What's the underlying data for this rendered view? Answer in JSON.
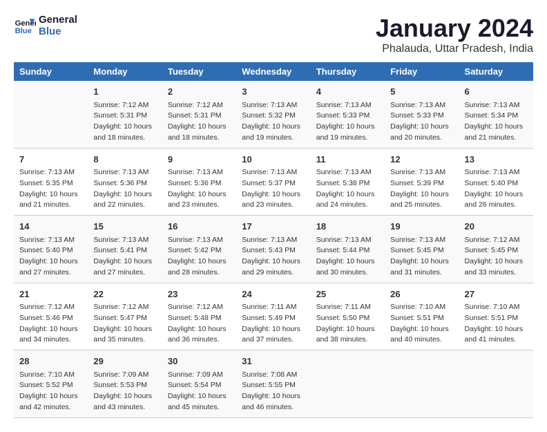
{
  "logo": {
    "line1": "General",
    "line2": "Blue"
  },
  "title": "January 2024",
  "subtitle": "Phalauda, Uttar Pradesh, India",
  "days_of_week": [
    "Sunday",
    "Monday",
    "Tuesday",
    "Wednesday",
    "Thursday",
    "Friday",
    "Saturday"
  ],
  "weeks": [
    [
      {
        "day": "",
        "info": ""
      },
      {
        "day": "1",
        "info": "Sunrise: 7:12 AM\nSunset: 5:31 PM\nDaylight: 10 hours\nand 18 minutes."
      },
      {
        "day": "2",
        "info": "Sunrise: 7:12 AM\nSunset: 5:31 PM\nDaylight: 10 hours\nand 18 minutes."
      },
      {
        "day": "3",
        "info": "Sunrise: 7:13 AM\nSunset: 5:32 PM\nDaylight: 10 hours\nand 19 minutes."
      },
      {
        "day": "4",
        "info": "Sunrise: 7:13 AM\nSunset: 5:33 PM\nDaylight: 10 hours\nand 19 minutes."
      },
      {
        "day": "5",
        "info": "Sunrise: 7:13 AM\nSunset: 5:33 PM\nDaylight: 10 hours\nand 20 minutes."
      },
      {
        "day": "6",
        "info": "Sunrise: 7:13 AM\nSunset: 5:34 PM\nDaylight: 10 hours\nand 21 minutes."
      }
    ],
    [
      {
        "day": "7",
        "info": "Sunrise: 7:13 AM\nSunset: 5:35 PM\nDaylight: 10 hours\nand 21 minutes."
      },
      {
        "day": "8",
        "info": "Sunrise: 7:13 AM\nSunset: 5:36 PM\nDaylight: 10 hours\nand 22 minutes."
      },
      {
        "day": "9",
        "info": "Sunrise: 7:13 AM\nSunset: 5:36 PM\nDaylight: 10 hours\nand 23 minutes."
      },
      {
        "day": "10",
        "info": "Sunrise: 7:13 AM\nSunset: 5:37 PM\nDaylight: 10 hours\nand 23 minutes."
      },
      {
        "day": "11",
        "info": "Sunrise: 7:13 AM\nSunset: 5:38 PM\nDaylight: 10 hours\nand 24 minutes."
      },
      {
        "day": "12",
        "info": "Sunrise: 7:13 AM\nSunset: 5:39 PM\nDaylight: 10 hours\nand 25 minutes."
      },
      {
        "day": "13",
        "info": "Sunrise: 7:13 AM\nSunset: 5:40 PM\nDaylight: 10 hours\nand 26 minutes."
      }
    ],
    [
      {
        "day": "14",
        "info": "Sunrise: 7:13 AM\nSunset: 5:40 PM\nDaylight: 10 hours\nand 27 minutes."
      },
      {
        "day": "15",
        "info": "Sunrise: 7:13 AM\nSunset: 5:41 PM\nDaylight: 10 hours\nand 27 minutes."
      },
      {
        "day": "16",
        "info": "Sunrise: 7:13 AM\nSunset: 5:42 PM\nDaylight: 10 hours\nand 28 minutes."
      },
      {
        "day": "17",
        "info": "Sunrise: 7:13 AM\nSunset: 5:43 PM\nDaylight: 10 hours\nand 29 minutes."
      },
      {
        "day": "18",
        "info": "Sunrise: 7:13 AM\nSunset: 5:44 PM\nDaylight: 10 hours\nand 30 minutes."
      },
      {
        "day": "19",
        "info": "Sunrise: 7:13 AM\nSunset: 5:45 PM\nDaylight: 10 hours\nand 31 minutes."
      },
      {
        "day": "20",
        "info": "Sunrise: 7:12 AM\nSunset: 5:45 PM\nDaylight: 10 hours\nand 33 minutes."
      }
    ],
    [
      {
        "day": "21",
        "info": "Sunrise: 7:12 AM\nSunset: 5:46 PM\nDaylight: 10 hours\nand 34 minutes."
      },
      {
        "day": "22",
        "info": "Sunrise: 7:12 AM\nSunset: 5:47 PM\nDaylight: 10 hours\nand 35 minutes."
      },
      {
        "day": "23",
        "info": "Sunrise: 7:12 AM\nSunset: 5:48 PM\nDaylight: 10 hours\nand 36 minutes."
      },
      {
        "day": "24",
        "info": "Sunrise: 7:11 AM\nSunset: 5:49 PM\nDaylight: 10 hours\nand 37 minutes."
      },
      {
        "day": "25",
        "info": "Sunrise: 7:11 AM\nSunset: 5:50 PM\nDaylight: 10 hours\nand 38 minutes."
      },
      {
        "day": "26",
        "info": "Sunrise: 7:10 AM\nSunset: 5:51 PM\nDaylight: 10 hours\nand 40 minutes."
      },
      {
        "day": "27",
        "info": "Sunrise: 7:10 AM\nSunset: 5:51 PM\nDaylight: 10 hours\nand 41 minutes."
      }
    ],
    [
      {
        "day": "28",
        "info": "Sunrise: 7:10 AM\nSunset: 5:52 PM\nDaylight: 10 hours\nand 42 minutes."
      },
      {
        "day": "29",
        "info": "Sunrise: 7:09 AM\nSunset: 5:53 PM\nDaylight: 10 hours\nand 43 minutes."
      },
      {
        "day": "30",
        "info": "Sunrise: 7:09 AM\nSunset: 5:54 PM\nDaylight: 10 hours\nand 45 minutes."
      },
      {
        "day": "31",
        "info": "Sunrise: 7:08 AM\nSunset: 5:55 PM\nDaylight: 10 hours\nand 46 minutes."
      },
      {
        "day": "",
        "info": ""
      },
      {
        "day": "",
        "info": ""
      },
      {
        "day": "",
        "info": ""
      }
    ]
  ]
}
